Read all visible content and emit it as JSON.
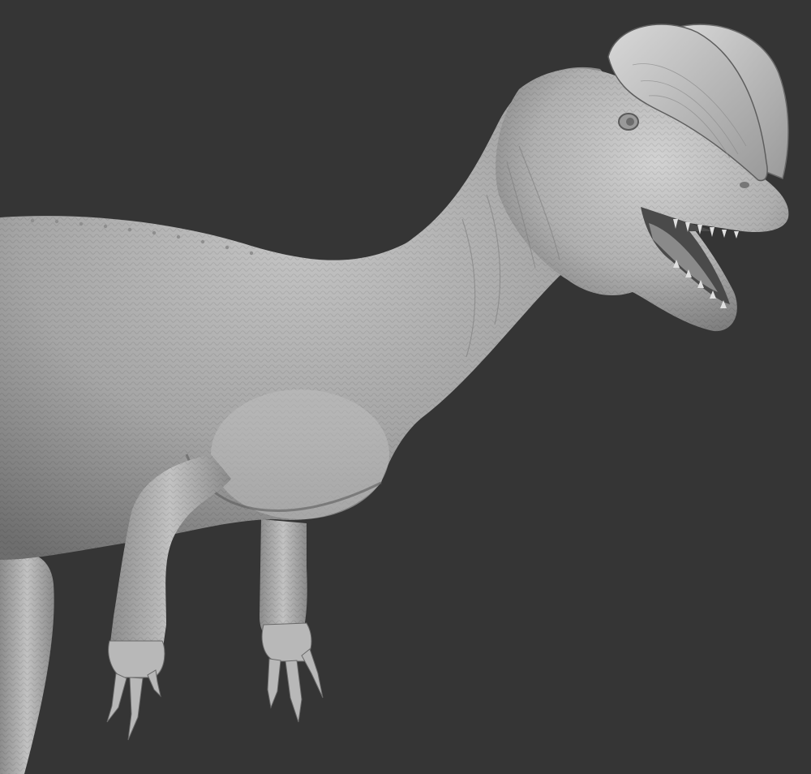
{
  "scene": {
    "subject": "dilophosaurus-sculpt",
    "background_color": "#353535",
    "clay_color": "#a9a9a9",
    "clay_highlight": "#cdcdcd",
    "clay_shadow": "#6a6a6a",
    "mouth_color": "#4a4a4a"
  }
}
